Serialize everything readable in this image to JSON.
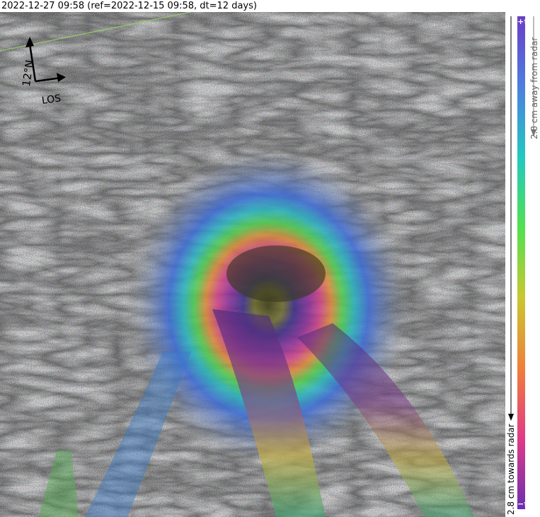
{
  "header": {
    "caption": "2022-12-27 09:58 (ref=2022-12-15 09:58, dt=12 days)"
  },
  "compass": {
    "north_label": "12°N",
    "los_label": "LOS"
  },
  "colorbar": {
    "top_symbol": "+π",
    "bottom_symbol": "−π",
    "away_label": "2.8 cm away from radar",
    "towards_label": "2.8 cm towards radar",
    "colors": [
      "#6a2fb0",
      "#e03a88",
      "#f07f3a",
      "#c8c830",
      "#52e050",
      "#22c9c0",
      "#4d7fe0",
      "#6a3dc8"
    ]
  },
  "map": {
    "kind": "interferogram"
  }
}
